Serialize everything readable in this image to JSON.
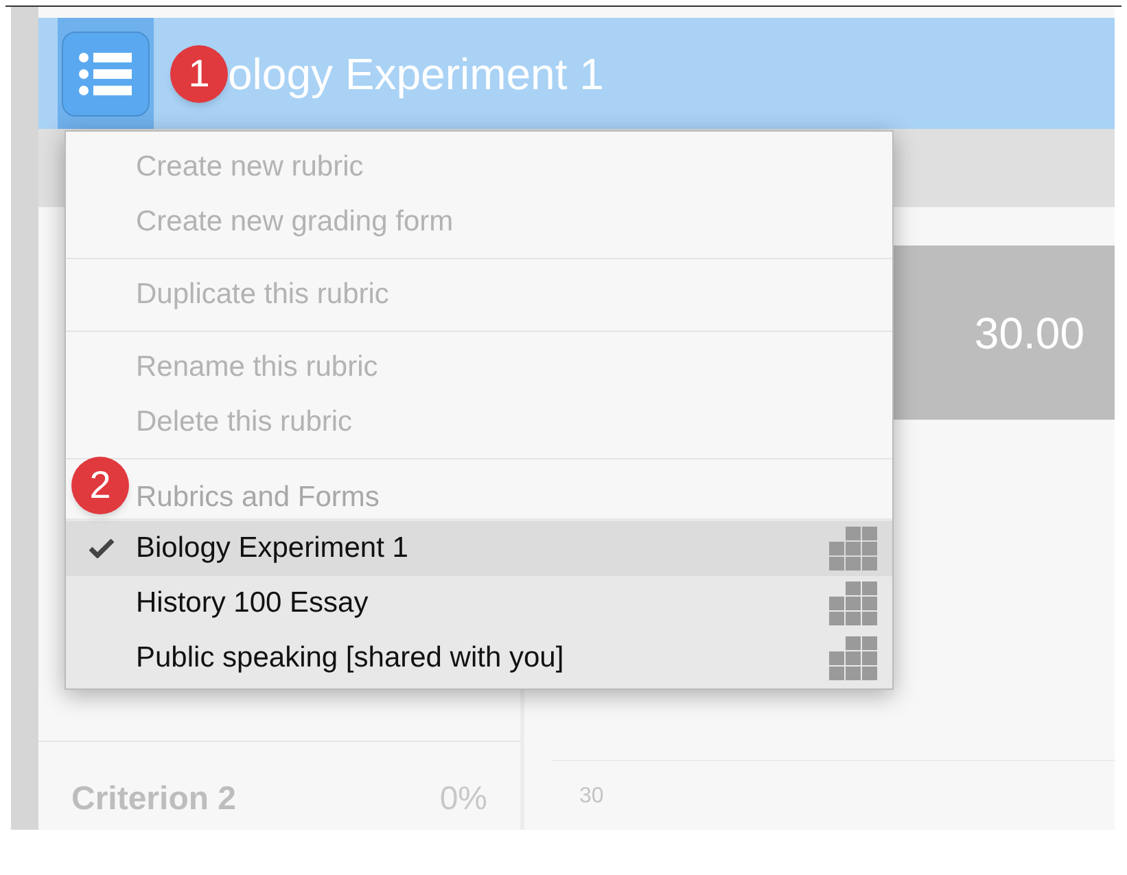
{
  "header": {
    "title": "ology Experiment 1",
    "badge": "1"
  },
  "score": "30.00",
  "criterion": {
    "name": "Criterion 2",
    "weight": "0%"
  },
  "level_points": "30",
  "menu": {
    "actions": [
      [
        "Create new rubric",
        "Create new grading form"
      ],
      [
        "Duplicate this rubric"
      ],
      [
        "Rename this rubric",
        "Delete this rubric"
      ]
    ],
    "section_label": "Rubrics and Forms",
    "badge": "2",
    "items": [
      {
        "label": "Biology Experiment 1",
        "selected": true
      },
      {
        "label": "History 100 Essay",
        "selected": false
      },
      {
        "label": "Public speaking [shared with you]",
        "selected": false
      }
    ]
  }
}
